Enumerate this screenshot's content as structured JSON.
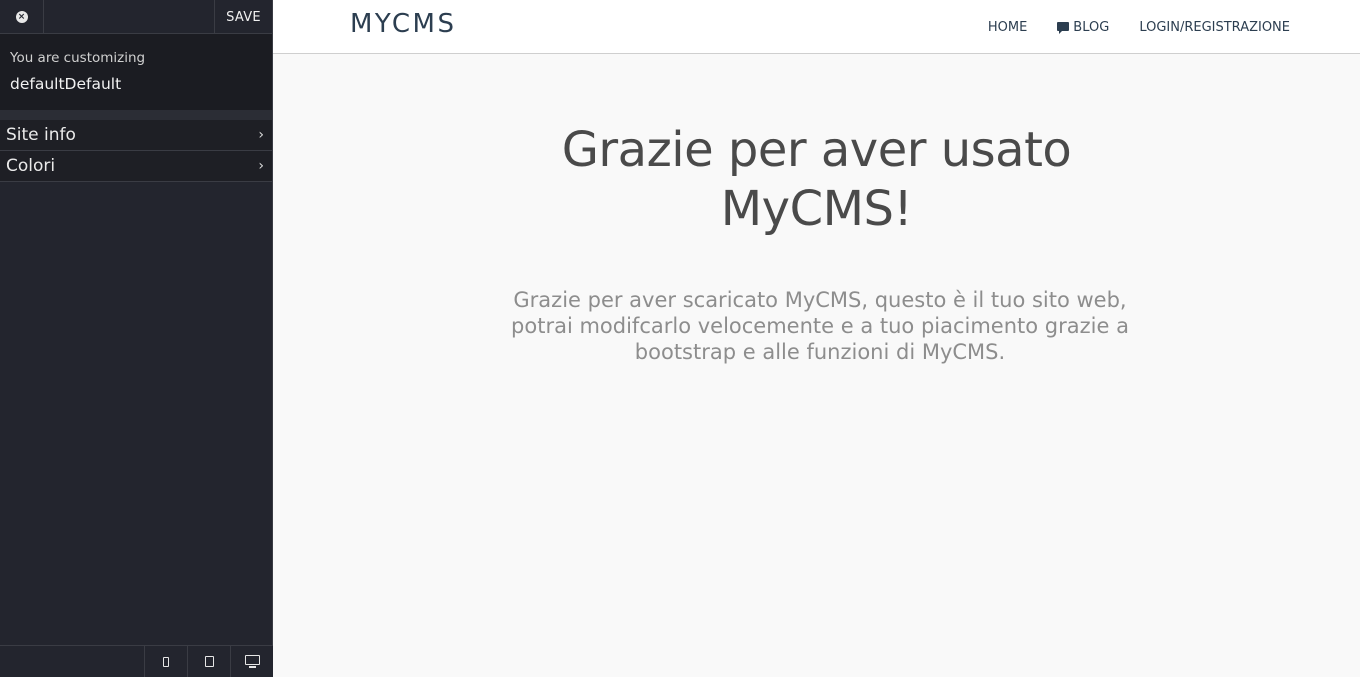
{
  "customizer": {
    "save_label": "SAVE",
    "customizing_label": "You are customizing",
    "theme_name": "defaultDefault",
    "sections": [
      {
        "label": "Site info"
      },
      {
        "label": "Colori"
      }
    ]
  },
  "site": {
    "brand": "MYCMS",
    "nav": {
      "home": "HOME",
      "blog": "BLOG",
      "login": "LOGIN/REGISTRAZIONE"
    },
    "hero": {
      "title_line1": "Grazie per aver usato",
      "title_line2": "MyCMS!",
      "text": "Grazie per aver scaricato MyCMS, questo è il tuo sito web, potrai modifcarlo velocemente e a tuo piacimento grazie a bootstrap e alle funzioni di MyCMS."
    }
  },
  "icons": {
    "close": "close-icon",
    "chevron": "chevron-right-icon",
    "comment": "comment-icon",
    "devices": [
      "mobile-icon",
      "tablet-icon",
      "desktop-icon"
    ]
  },
  "colors": {
    "sidebar_bg": "#23252e",
    "brand_text": "#2c3e50",
    "preview_bg": "#f9f9f9"
  }
}
